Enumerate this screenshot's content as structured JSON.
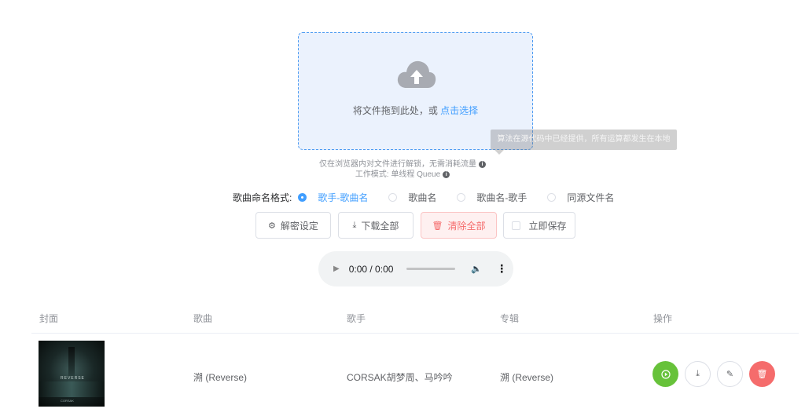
{
  "upload": {
    "drop_text": "将文件拖到此处，或",
    "drop_link": "点击选择"
  },
  "tooltip": {
    "text": "算法在源代码中已经提供，所有运算都发生在本地"
  },
  "tips": {
    "line1": "仅在浏览器内对文件进行解锁，无需消耗流量",
    "line2": "工作模式: 单线程 Queue"
  },
  "naming": {
    "label": "歌曲命名格式:",
    "options": [
      {
        "label": "歌手-歌曲名",
        "selected": true
      },
      {
        "label": "歌曲名",
        "selected": false
      },
      {
        "label": "歌曲名-歌手",
        "selected": false
      },
      {
        "label": "同源文件名",
        "selected": false
      }
    ]
  },
  "toolbar": {
    "settings_label": "解密设定",
    "download_all_label": "下载全部",
    "clear_all_label": "清除全部",
    "save_now_label": "立即保存"
  },
  "player": {
    "time": "0:00 / 0:00"
  },
  "table": {
    "columns": [
      "封面",
      "歌曲",
      "歌手",
      "专辑",
      "操作"
    ],
    "rows": [
      {
        "cover_text": "REVERSE",
        "cover_tag": "CORSAK",
        "song": "溯 (Reverse)",
        "artist": "CORSAK胡梦周、马吟吟",
        "album": "溯 (Reverse)"
      }
    ]
  },
  "colors": {
    "primary": "#409eff",
    "success": "#67c23a",
    "danger": "#f56c6c"
  },
  "icons": {
    "upload": "cloud-upload-icon",
    "settings": "gear-icon",
    "download": "download-icon",
    "delete": "trash-icon",
    "edit": "edit-icon",
    "play": "play-icon"
  }
}
